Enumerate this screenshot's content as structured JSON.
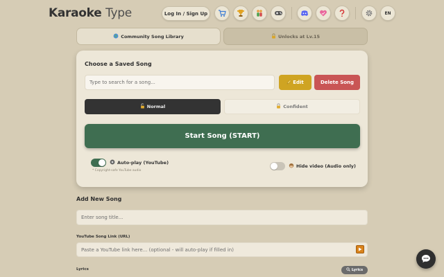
{
  "header": {
    "logo_main": "Karaoke",
    "logo_accent": "Type",
    "login_label": "Log In / Sign Up",
    "language": "EN",
    "icons": [
      "cart-icon",
      "trophy-icon",
      "people-icon",
      "gamepad-icon",
      "discord-icon",
      "heart-icon",
      "question-icon",
      "gear-icon"
    ]
  },
  "tabs": [
    {
      "label": "Community Song Library",
      "icon": "globe-icon",
      "active": true
    },
    {
      "label": "Unlocks at Lv.15",
      "icon": "lock-icon",
      "active": false
    }
  ],
  "saved_song": {
    "title": "Choose a Saved Song",
    "search_placeholder": "Type to search for a song...",
    "edit_label": "Edit",
    "delete_label": "Delete Song",
    "modes": [
      {
        "label": "Normal",
        "selected": true
      },
      {
        "label": "Confident",
        "selected": false
      }
    ],
    "start_label": "Start Song (START)",
    "autoplay_label": "Auto-play (YouTube)",
    "autoplay_on": true,
    "autoplay_hint": "* Copyright-safe YouTube audio",
    "hide_video_label": "Hide video (Audio only)",
    "hide_video_on": false
  },
  "add_song": {
    "title": "Add New Song",
    "title_placeholder": "Enter song title...",
    "youtube_label": "YouTube Song Link (URL)",
    "youtube_placeholder": "Paste a YouTube link here... (optional - will auto-play if filled in)",
    "lyrics_label": "Lyrics",
    "lyrics_button": "Lyrics"
  },
  "colors": {
    "background": "#d6ccb5",
    "start_green": "#3f6e51",
    "edit_gold": "#cfa422",
    "delete_red": "#c95555"
  }
}
